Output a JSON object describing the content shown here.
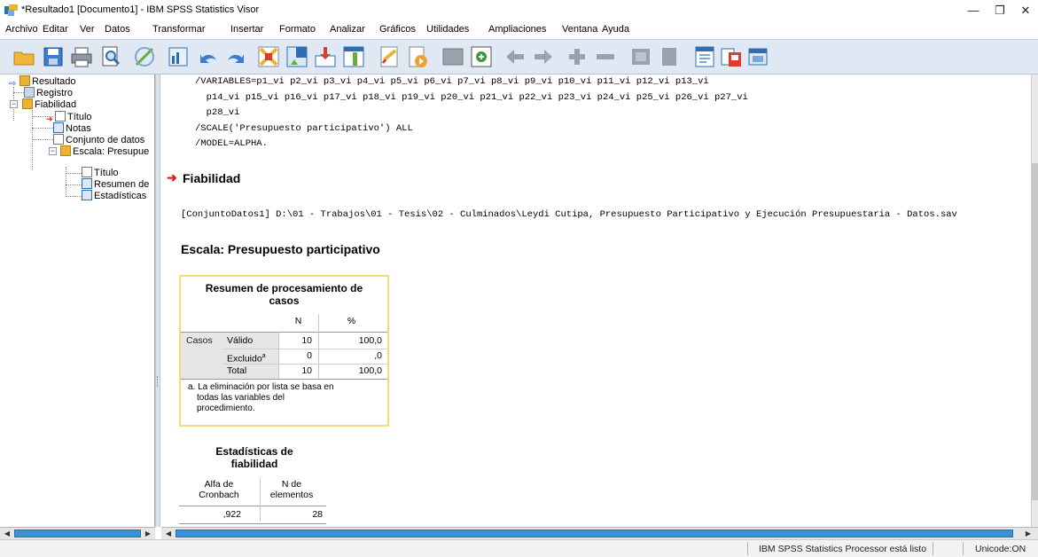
{
  "window": {
    "title": "*Resultado1 [Documento1] - IBM SPSS Statistics Visor",
    "minimize": "—",
    "maximize": "❐",
    "close": "✕"
  },
  "menu": [
    {
      "label": "Archivo"
    },
    {
      "label": "Editar"
    },
    {
      "label": "Ver"
    },
    {
      "label": "Datos"
    },
    {
      "label": "Transformar"
    },
    {
      "label": "Insertar"
    },
    {
      "label": "Formato"
    },
    {
      "label": "Analizar"
    },
    {
      "label": "Gráficos"
    },
    {
      "label": "Utilidades"
    },
    {
      "label": "Ampliaciones"
    },
    {
      "label": "Ventana"
    },
    {
      "label": "Ayuda"
    }
  ],
  "toolbar_icons": [
    "open-icon",
    "save-icon",
    "print-icon",
    "print-preview-icon",
    "export-icon",
    "go-to-data-icon",
    "undo-icon",
    "redo-icon",
    "go-to-case-icon",
    "go-to-variable-icon",
    "variables-icon",
    "insert-icon",
    "designate-window-icon",
    "run-icon",
    "collapse-icon",
    "expand-icon",
    "back-icon",
    "forward-icon",
    "expand-all-icon",
    "collapse-all-icon",
    "show-icon",
    "hide-icon",
    "insert-heading-icon",
    "insert-title-icon",
    "insert-text-icon"
  ],
  "tree": {
    "items": [
      {
        "label": "Resultado"
      },
      {
        "label": "Registro"
      },
      {
        "label": "Fiabilidad"
      },
      {
        "label": "Título"
      },
      {
        "label": "Notas"
      },
      {
        "label": "Conjunto de datos"
      },
      {
        "label": "Escala: Presupue"
      },
      {
        "label": "Título"
      },
      {
        "label": "Resumen de"
      },
      {
        "label": "Estadísticas"
      }
    ]
  },
  "syntax": {
    "line1": "/VARIABLES=p1_vi p2_vi p3_vi p4_vi p5_vi p6_vi p7_vi p8_vi p9_vi p10_vi p11_vi p12_vi p13_vi",
    "line2": "  p14_vi p15_vi p16_vi p17_vi p18_vi p19_vi p20_vi p21_vi p22_vi p23_vi p24_vi p25_vi p26_vi p27_vi",
    "line3": "  p28_vi",
    "line4": "/SCALE('Presupuesto participativo') ALL",
    "line5": "/MODEL=ALPHA."
  },
  "output": {
    "heading": "Fiabilidad",
    "dataset_path": "[ConjuntoDatos1] D:\\01 - Trabajos\\01 - Tesis\\02 - Culminados\\Leydi Cutipa, Presupuesto Participativo y Ejecución Presupuestaria - Datos.sav",
    "scale_heading": "Escala: Presupuesto participativo"
  },
  "case_summary": {
    "title_line1": "Resumen de procesamiento de",
    "title_line2": "casos",
    "col_n": "N",
    "col_pct": "%",
    "row_group": "Casos",
    "rows": [
      {
        "label": "Válido",
        "n": "10",
        "pct": "100,0"
      },
      {
        "label": "Excluido",
        "sup": "a",
        "n": "0",
        "pct": ",0"
      },
      {
        "label": "Total",
        "n": "10",
        "pct": "100,0"
      }
    ],
    "footnote_line1": "a. La eliminación por lista se basa en",
    "footnote_line2": "todas las variables del",
    "footnote_line3": "procedimiento."
  },
  "reliability": {
    "title_line1": "Estadísticas de",
    "title_line2": "fiabilidad",
    "col1_line1": "Alfa de",
    "col1_line2": "Cronbach",
    "col2_line1": "N de",
    "col2_line2": "elementos",
    "alpha": ",922",
    "n_items": "28"
  },
  "status": {
    "processor": "IBM SPSS Statistics Processor está listo",
    "unicode": "Unicode:ON"
  }
}
